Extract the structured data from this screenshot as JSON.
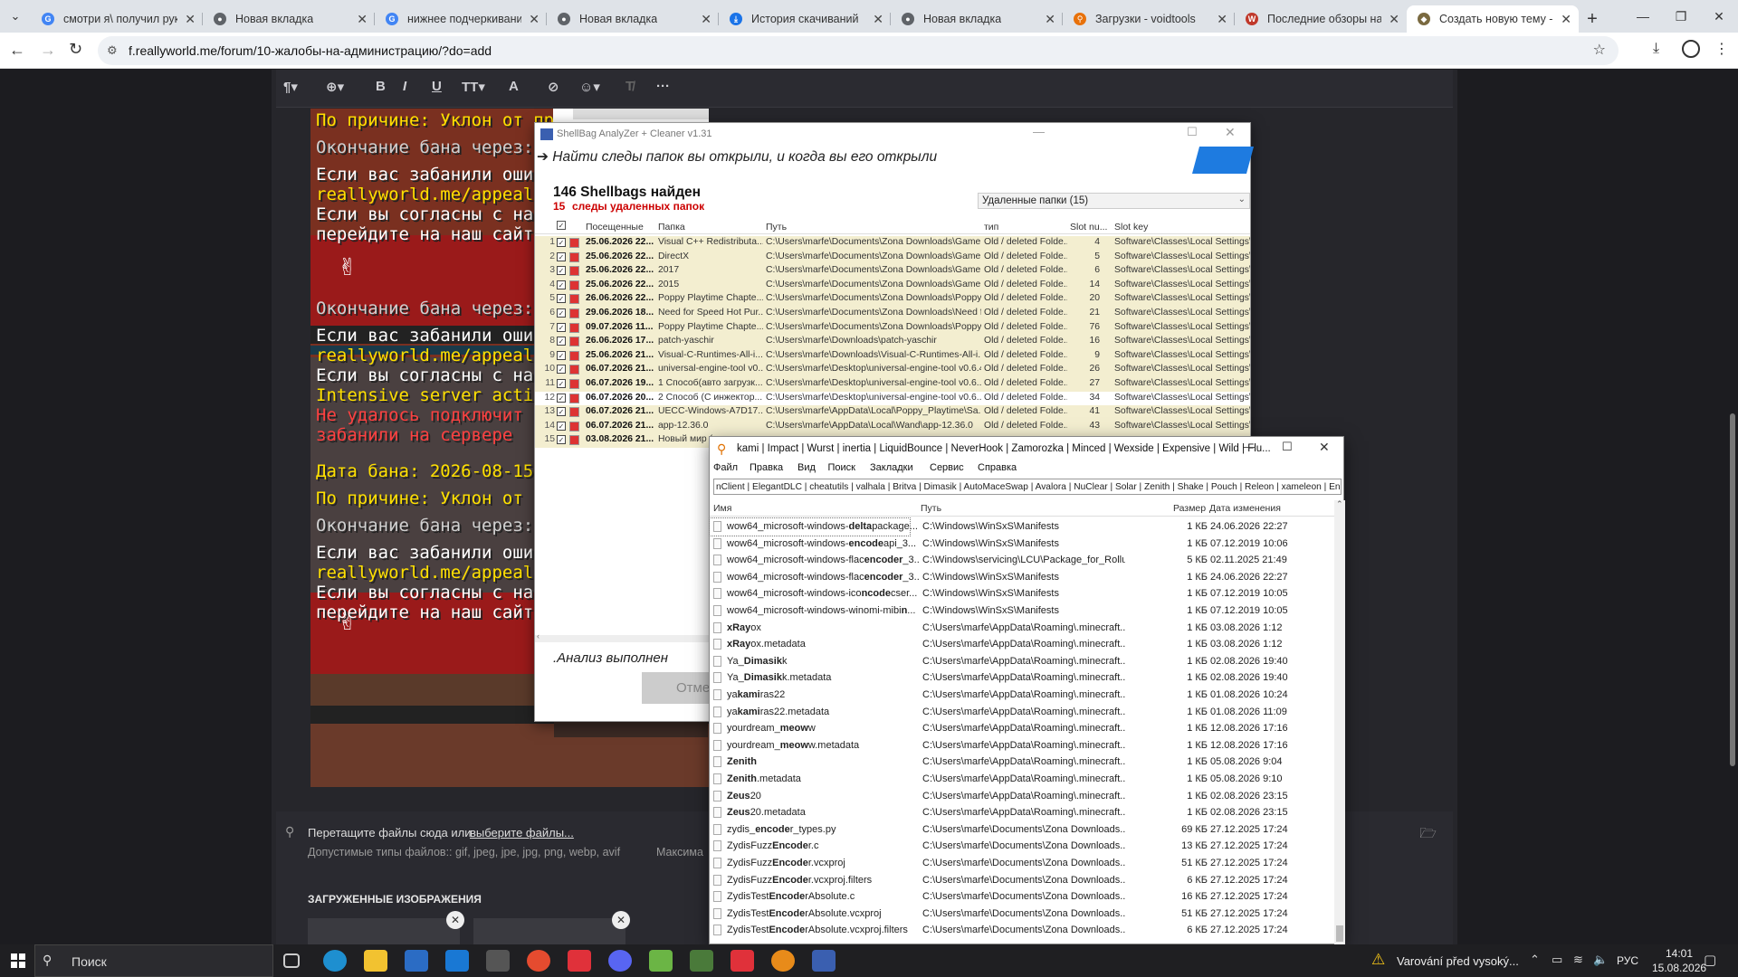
{
  "browser": {
    "tabs": [
      {
        "title": "смотри я\\ получил руку",
        "favicon": "G",
        "color": "#4285f4"
      },
      {
        "title": "Новая вкладка",
        "favicon": "chrome",
        "color": "#5f6368"
      },
      {
        "title": "нижнее подчеркивание",
        "favicon": "G",
        "color": "#4285f4"
      },
      {
        "title": "Новая вкладка",
        "favicon": "chrome",
        "color": "#5f6368"
      },
      {
        "title": "История скачиваний",
        "favicon": "download",
        "color": "#1a73e8"
      },
      {
        "title": "Новая вкладка",
        "favicon": "chrome",
        "color": "#5f6368"
      },
      {
        "title": "Загрузки - voidtools",
        "favicon": "search",
        "color": "#e8710a"
      },
      {
        "title": "Последние обзоры на Pr",
        "favicon": "W",
        "color": "#c0392b"
      },
      {
        "title": "Создать новую тему - Re",
        "favicon": "rw",
        "color": "#7a6a40"
      }
    ],
    "url": "f.reallyworld.me/forum/10-жалобы-на-администрацию/?do=add"
  },
  "minecraft_text": [
    {
      "text": "По причине: Уклон от пр",
      "color": "#ffe000"
    },
    {
      "text": "Окончание бана через:",
      "color": "#d0d0d0"
    },
    {
      "text": "Если вас забанили ошиб",
      "color": "#ffffff"
    },
    {
      "text": "reallyworld.me/appeals",
      "color": "#ffe000"
    },
    {
      "text": "Если вы согласны с нак",
      "color": "#ffffff"
    },
    {
      "text": "перейдите на наш сайт",
      "color": "#ffffff"
    },
    {
      "text": "Окончание бана через:",
      "color": "#d0d0d0"
    },
    {
      "text": "Если вас забанили ошиб",
      "color": "#ffffff"
    },
    {
      "text": "reallyworld.me/appeals",
      "color": "#ffe000"
    },
    {
      "text": "Если вы согласны с нак",
      "color": "#ffffff"
    },
    {
      "text": "Intensive server activit",
      "color": "#ffe000"
    },
    {
      "text": "Не удалось подключит",
      "color": "#ff4040"
    },
    {
      "text": "забанили на сервере",
      "color": "#ff4040"
    },
    {
      "text": "Дата бана: 2026-08-15",
      "color": "#ffe000"
    },
    {
      "text": "По причине: Уклон от пр",
      "color": "#ffe000"
    },
    {
      "text": "Окончание бана через:",
      "color": "#d0d0d0"
    },
    {
      "text": "Если вас забанили ошиб",
      "color": "#ffffff"
    },
    {
      "text": "reallyworld.me/appeals",
      "color": "#ffe000"
    },
    {
      "text": "Если вы согласны с нак",
      "color": "#ffffff"
    },
    {
      "text": "перейдите на наш сайт",
      "color": "#ffffff"
    }
  ],
  "upload": {
    "drop_text": "Перетащите файлы сюда или",
    "choose_link": "выберите файлы...",
    "allowed_types": "Допустимые типы файлов:: gif, jpeg, jpe, jpg, png, webp, avif",
    "max_label": "Максима",
    "uploaded_heading": "ЗАГРУЖЕННЫЕ ИЗОБРАЖЕНИЯ"
  },
  "shellbag": {
    "title": "ShellBag AnalyZer + Cleaner v1.31",
    "slogan": "➔ Найти следы папок вы открыли, и когда вы его открыли",
    "count_title": "146 Shellbags найден",
    "deleted_num": "15",
    "deleted_label": "следы удаленных папок",
    "filter_label": "Удаленные папки  (15)",
    "headers": [
      "Посещенные",
      "Папка",
      "Путь",
      "тип",
      "Slot nu...",
      "Slot key"
    ],
    "rows": [
      {
        "n": "1",
        "date": "25.06.2026 22...",
        "folder": "Visual C++ Redistributa...",
        "path": "C:\\Users\\marfe\\Documents\\Zona Downloads\\Game ...",
        "type": "Old / deleted Folde...",
        "slot": "4",
        "key": "Software\\Classes\\Local Settings\\S"
      },
      {
        "n": "2",
        "date": "25.06.2026 22...",
        "folder": "DirectX",
        "path": "C:\\Users\\marfe\\Documents\\Zona Downloads\\Game ...",
        "type": "Old / deleted Folde...",
        "slot": "5",
        "key": "Software\\Classes\\Local Settings\\S"
      },
      {
        "n": "3",
        "date": "25.06.2026 22...",
        "folder": "2017",
        "path": "C:\\Users\\marfe\\Documents\\Zona Downloads\\Game ...",
        "type": "Old / deleted Folde...",
        "slot": "6",
        "key": "Software\\Classes\\Local Settings\\S"
      },
      {
        "n": "4",
        "date": "25.06.2026 22...",
        "folder": "2015",
        "path": "C:\\Users\\marfe\\Documents\\Zona Downloads\\Game ...",
        "type": "Old / deleted Folde...",
        "slot": "14",
        "key": "Software\\Classes\\Local Settings\\S"
      },
      {
        "n": "5",
        "date": "26.06.2026 22...",
        "folder": "Poppy Playtime Chapte...",
        "path": "C:\\Users\\marfe\\Documents\\Zona Downloads\\Poppy...",
        "type": "Old / deleted Folde...",
        "slot": "20",
        "key": "Software\\Classes\\Local Settings\\S"
      },
      {
        "n": "6",
        "date": "29.06.2026 18...",
        "folder": "Need for Speed Hot Pur...",
        "path": "C:\\Users\\marfe\\Documents\\Zona Downloads\\Need f...",
        "type": "Old / deleted Folde...",
        "slot": "21",
        "key": "Software\\Classes\\Local Settings\\S"
      },
      {
        "n": "7",
        "date": "09.07.2026 11...",
        "folder": "Poppy Playtime Chapte...",
        "path": "C:\\Users\\marfe\\Documents\\Zona Downloads\\Poppy...",
        "type": "Old / deleted Folde...",
        "slot": "76",
        "key": "Software\\Classes\\Local Settings\\S"
      },
      {
        "n": "8",
        "date": "26.06.2026 17...",
        "folder": "patch-yaschir",
        "path": "C:\\Users\\marfe\\Downloads\\patch-yaschir",
        "type": "Old / deleted Folde...",
        "slot": "16",
        "key": "Software\\Classes\\Local Settings\\S"
      },
      {
        "n": "9",
        "date": "25.06.2026 21...",
        "folder": "Visual-C-Runtimes-All-i...",
        "path": "C:\\Users\\marfe\\Downloads\\Visual-C-Runtimes-All-i...",
        "type": "Old / deleted Folde...",
        "slot": "9",
        "key": "Software\\Classes\\Local Settings\\S"
      },
      {
        "n": "10",
        "date": "06.07.2026 21...",
        "folder": "universal-engine-tool v0...",
        "path": "C:\\Users\\marfe\\Desktop\\universal-engine-tool v0.6.4",
        "type": "Old / deleted Folde...",
        "slot": "26",
        "key": "Software\\Classes\\Local Settings\\S"
      },
      {
        "n": "11",
        "date": "06.07.2026 19...",
        "folder": "1 Способ(авто загрузк...",
        "path": "C:\\Users\\marfe\\Desktop\\universal-engine-tool v0.6...",
        "type": "Old / deleted Folde...",
        "slot": "27",
        "key": "Software\\Classes\\Local Settings\\S"
      },
      {
        "n": "12",
        "date": "06.07.2026 20...",
        "folder": "2 Способ (С инжектор...",
        "path": "C:\\Users\\marfe\\Desktop\\universal-engine-tool v0.6....",
        "type": "Old / deleted Folde...",
        "slot": "34",
        "key": "Software\\Classes\\Local Settings\\S"
      },
      {
        "n": "13",
        "date": "06.07.2026 21...",
        "folder": "UECC-Windows-A7D17...",
        "path": "C:\\Users\\marfe\\AppData\\Local\\Poppy_Playtime\\Sa...",
        "type": "Old / deleted Folde...",
        "slot": "41",
        "key": "Software\\Classes\\Local Settings\\S"
      },
      {
        "n": "14",
        "date": "06.07.2026 21...",
        "folder": "app-12.36.0",
        "path": "C:\\Users\\marfe\\AppData\\Local\\Wand\\app-12.36.0",
        "type": "Old / deleted Folde...",
        "slot": "43",
        "key": "Software\\Classes\\Local Settings\\S"
      },
      {
        "n": "15",
        "date": "03.08.2026 21...",
        "folder": "Новый мир (",
        "path": "",
        "type": "",
        "slot": "",
        "key": ""
      }
    ],
    "status": ".Анализ выполнен",
    "cancel_button": "Отме"
  },
  "everything": {
    "title": "kami | Impact | Wurst | inertia | LiquidBounce | NeverHook | Zamorozka | Minced | Wexside | Expensive | Wild | Flu...",
    "menu": [
      "Файл",
      "Правка",
      "Вид",
      "Поиск",
      "Закладки",
      "Сервис",
      "Справка"
    ],
    "search": "nClient | ElegantDLC | cheatutils | valhala | Britva | Dimasik | AutoMaceSwap | Avalora | NuClear | Solar | Zenith | Shake | Pouch | Releon | xameleon | Enough",
    "headers": [
      "Имя",
      "Путь",
      "Размер",
      "Дата изменения"
    ],
    "rows": [
      {
        "pre": "wow64_microsoft-windows-",
        "hl": "delta",
        "post": "package...",
        "path": "C:\\Windows\\WinSxS\\Manifests",
        "size": "1 КБ",
        "date": "24.06.2026 22:27"
      },
      {
        "pre": "wow64_microsoft-windows-",
        "hl": "encode",
        "post": "api_3...",
        "path": "C:\\Windows\\WinSxS\\Manifests",
        "size": "1 КБ",
        "date": "07.12.2019 10:06"
      },
      {
        "pre": "wow64_microsoft-windows-flac",
        "hl": "encoder",
        "post": "_3...",
        "path": "C:\\Windows\\servicing\\LCU\\Package_for_Rollu...",
        "size": "5 КБ",
        "date": "02.11.2025 21:49"
      },
      {
        "pre": "wow64_microsoft-windows-flac",
        "hl": "encoder",
        "post": "_3...",
        "path": "C:\\Windows\\WinSxS\\Manifests",
        "size": "1 КБ",
        "date": "24.06.2026 22:27"
      },
      {
        "pre": "wow64_microsoft-windows-ico",
        "hl": "ncode",
        "post": "cser...",
        "path": "C:\\Windows\\WinSxS\\Manifests",
        "size": "1 КБ",
        "date": "07.12.2019 10:05"
      },
      {
        "pre": "wow64_microsoft-windows-winomi-mibi",
        "hl": "n",
        "post": "...",
        "path": "C:\\Windows\\WinSxS\\Manifests",
        "size": "1 КБ",
        "date": "07.12.2019 10:05"
      },
      {
        "pre": "",
        "hl": "xRay",
        "post": "ox",
        "path": "C:\\Users\\marfe\\AppData\\Roaming\\.minecraft...",
        "size": "1 КБ",
        "date": "03.08.2026 1:12"
      },
      {
        "pre": "",
        "hl": "xRay",
        "post": "ox.metadata",
        "path": "C:\\Users\\marfe\\AppData\\Roaming\\.minecraft...",
        "size": "1 КБ",
        "date": "03.08.2026 1:12"
      },
      {
        "pre": "Ya_",
        "hl": "Dimasik",
        "post": "k",
        "path": "C:\\Users\\marfe\\AppData\\Roaming\\.minecraft...",
        "size": "1 КБ",
        "date": "02.08.2026 19:40"
      },
      {
        "pre": "Ya_",
        "hl": "Dimasik",
        "post": "k.metadata",
        "path": "C:\\Users\\marfe\\AppData\\Roaming\\.minecraft...",
        "size": "1 КБ",
        "date": "02.08.2026 19:40"
      },
      {
        "pre": "ya",
        "hl": "kami",
        "post": "ras22",
        "path": "C:\\Users\\marfe\\AppData\\Roaming\\.minecraft...",
        "size": "1 КБ",
        "date": "01.08.2026 10:24"
      },
      {
        "pre": "ya",
        "hl": "kami",
        "post": "ras22.metadata",
        "path": "C:\\Users\\marfe\\AppData\\Roaming\\.minecraft...",
        "size": "1 КБ",
        "date": "01.08.2026 11:09"
      },
      {
        "pre": "yourdream_",
        "hl": "meow",
        "post": "w",
        "path": "C:\\Users\\marfe\\AppData\\Roaming\\.minecraft...",
        "size": "1 КБ",
        "date": "12.08.2026 17:16"
      },
      {
        "pre": "yourdream_",
        "hl": "meow",
        "post": "w.metadata",
        "path": "C:\\Users\\marfe\\AppData\\Roaming\\.minecraft...",
        "size": "1 КБ",
        "date": "12.08.2026 17:16"
      },
      {
        "pre": "",
        "hl": "Zenith",
        "post": "",
        "path": "C:\\Users\\marfe\\AppData\\Roaming\\.minecraft...",
        "size": "1 КБ",
        "date": "05.08.2026 9:04"
      },
      {
        "pre": "",
        "hl": "Zenith",
        "post": ".metadata",
        "path": "C:\\Users\\marfe\\AppData\\Roaming\\.minecraft...",
        "size": "1 КБ",
        "date": "05.08.2026 9:10"
      },
      {
        "pre": "",
        "hl": "Zeus",
        "post": "20",
        "path": "C:\\Users\\marfe\\AppData\\Roaming\\.minecraft...",
        "size": "1 КБ",
        "date": "02.08.2026 23:15"
      },
      {
        "pre": "",
        "hl": "Zeus",
        "post": "20.metadata",
        "path": "C:\\Users\\marfe\\AppData\\Roaming\\.minecraft...",
        "size": "1 КБ",
        "date": "02.08.2026 23:15"
      },
      {
        "pre": "zydis_",
        "hl": "encode",
        "post": "r_types.py",
        "path": "C:\\Users\\marfe\\Documents\\Zona Downloads...",
        "size": "69 КБ",
        "date": "27.12.2025 17:24"
      },
      {
        "pre": "ZydisFuzz",
        "hl": "Encode",
        "post": "r.c",
        "path": "C:\\Users\\marfe\\Documents\\Zona Downloads...",
        "size": "13 КБ",
        "date": "27.12.2025 17:24"
      },
      {
        "pre": "ZydisFuzz",
        "hl": "Encode",
        "post": "r.vcxproj",
        "path": "C:\\Users\\marfe\\Documents\\Zona Downloads...",
        "size": "51 КБ",
        "date": "27.12.2025 17:24"
      },
      {
        "pre": "ZydisFuzz",
        "hl": "Encode",
        "post": "r.vcxproj.filters",
        "path": "C:\\Users\\marfe\\Documents\\Zona Downloads...",
        "size": "6 КБ",
        "date": "27.12.2025 17:24"
      },
      {
        "pre": "ZydisTest",
        "hl": "Encode",
        "post": "rAbsolute.c",
        "path": "C:\\Users\\marfe\\Documents\\Zona Downloads...",
        "size": "16 КБ",
        "date": "27.12.2025 17:24"
      },
      {
        "pre": "ZydisTest",
        "hl": "Encode",
        "post": "rAbsolute.vcxproj",
        "path": "C:\\Users\\marfe\\Documents\\Zona Downloads...",
        "size": "51 КБ",
        "date": "27.12.2025 17:24"
      },
      {
        "pre": "ZydisTest",
        "hl": "Encode",
        "post": "rAbsolute.vcxproj.filters",
        "path": "C:\\Users\\marfe\\Documents\\Zona Downloads...",
        "size": "6 КБ",
        "date": "27.12.2025 17:24"
      }
    ]
  },
  "taskbar": {
    "search": "Поиск",
    "notification": "Varování před vysoký...",
    "lang": "РУС",
    "time": "14:01",
    "date": "15.08.2026"
  }
}
